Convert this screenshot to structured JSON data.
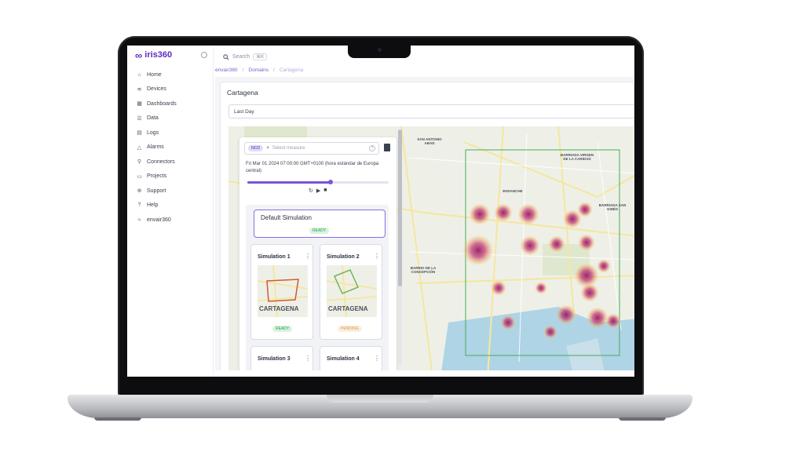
{
  "app": {
    "logo_text": "iris360",
    "logo_mark": "∞"
  },
  "sidebar": {
    "items": [
      {
        "label": "Home",
        "icon": "home-icon",
        "glyph": "⌂"
      },
      {
        "label": "Devices",
        "icon": "wifi-icon",
        "glyph": "≋"
      },
      {
        "label": "Dashboards",
        "icon": "grid-icon",
        "glyph": "▦"
      },
      {
        "label": "Data",
        "icon": "database-icon",
        "glyph": "☰"
      },
      {
        "label": "Logs",
        "icon": "file-icon",
        "glyph": "▤"
      },
      {
        "label": "Alarms",
        "icon": "warning-icon",
        "glyph": "△"
      },
      {
        "label": "Connectors",
        "icon": "plug-icon",
        "glyph": "⚲"
      },
      {
        "label": "Projects",
        "icon": "folder-icon",
        "glyph": "▭"
      },
      {
        "label": "Support",
        "icon": "globe-icon",
        "glyph": "⊕"
      },
      {
        "label": "Help",
        "icon": "help-icon",
        "glyph": "?"
      },
      {
        "label": "envair360",
        "icon": "layers-icon",
        "glyph": "≈"
      }
    ]
  },
  "topbar": {
    "search_placeholder": "Search",
    "search_shortcut": "⌘K"
  },
  "breadcrumb": {
    "items": [
      "envair360",
      "Domains",
      "Cartagena"
    ],
    "separator": "/"
  },
  "page": {
    "title": "Cartagena",
    "time_range": "Last Day"
  },
  "controls": {
    "measure_chip": "NO2",
    "measure_placeholder": "Select measure",
    "timestamp": "Fri Mar 01 2024 07:00:00 GMT+0100 (hora estándar de Europa central)",
    "timeline_progress": 0.59
  },
  "simulations": {
    "default": {
      "title": "Default Simulation",
      "status": "READY"
    },
    "cards": [
      {
        "title": "Simulation 1",
        "status": "READY"
      },
      {
        "title": "Simulation 2",
        "status": "PENDING"
      },
      {
        "title": "Simulation 3",
        "status": ""
      },
      {
        "title": "Simulation 4",
        "status": ""
      }
    ],
    "thumb_text": "CARTAGENA"
  },
  "map_labels": [
    "SAN ANTONIO ABAD",
    "BARRIADA VIRGEN DE LA CARIDAD",
    "ENSANCHE",
    "BARRIADA SAN GINÉS",
    "BARRIO DE LA CONCEPCIÓN"
  ],
  "colors": {
    "accent": "#5b2bbf",
    "ready": "#2f9a4d",
    "pending": "#d9954a"
  }
}
